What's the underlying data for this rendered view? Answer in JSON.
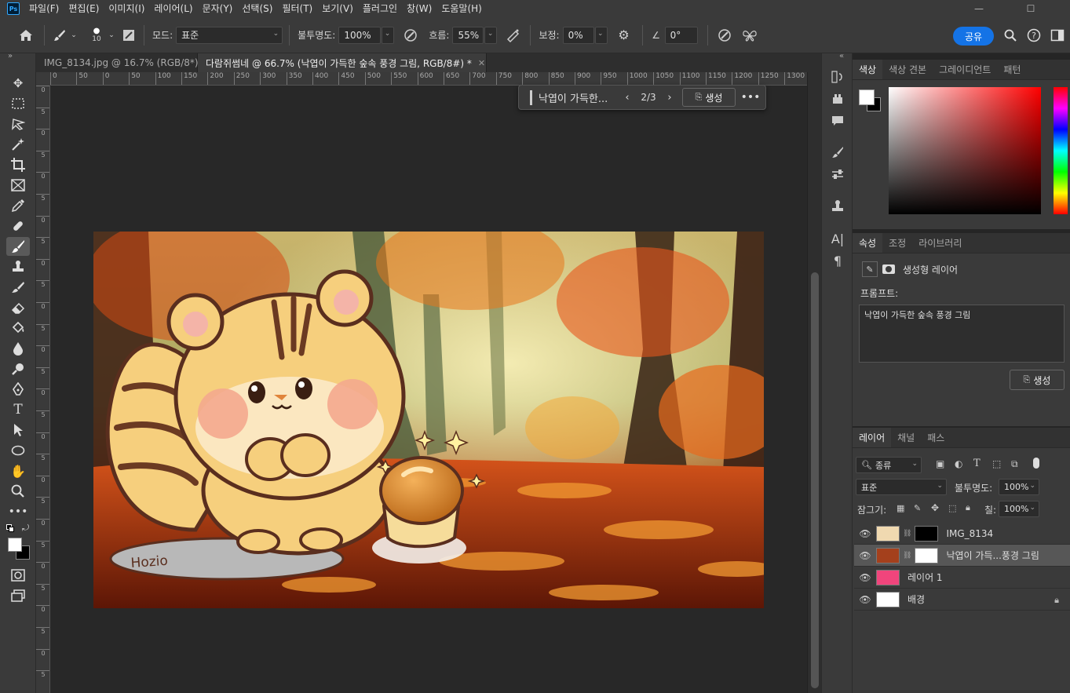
{
  "menubar": {
    "items": [
      "파일(F)",
      "편집(E)",
      "이미지(I)",
      "레이어(L)",
      "문자(Y)",
      "선택(S)",
      "필터(T)",
      "보기(V)",
      "플러그인",
      "창(W)",
      "도움말(H)"
    ],
    "logo": "Ps"
  },
  "options": {
    "brush_size": "10",
    "mode_label": "모드:",
    "mode_value": "표준",
    "opacity_label": "불투명도:",
    "opacity_value": "100%",
    "flow_label": "흐름:",
    "flow_value": "55%",
    "smoothing_label": "보정:",
    "smoothing_value": "0%",
    "angle_value": "0°",
    "share_label": "공유"
  },
  "tabs": [
    {
      "label": "IMG_8134.jpg @ 16.7% (RGB/8*)",
      "active": false
    },
    {
      "label": "다람쥐썸네 @ 66.7% (낙엽이 가득한 숲속 풍경 그림, RGB/8#) *",
      "active": true
    }
  ],
  "ruler": {
    "h_ticks": [
      "0",
      "50",
      "0",
      "50",
      "100",
      "150",
      "200",
      "250",
      "300",
      "350",
      "400",
      "450",
      "500",
      "550",
      "600",
      "650",
      "700",
      "750",
      "800",
      "850",
      "900",
      "950",
      "1000",
      "1050",
      "1100",
      "1150",
      "1200",
      "1250",
      "1300",
      "13"
    ],
    "v_ticks": [
      "0",
      "5",
      "0",
      "5",
      "0",
      "5",
      "0",
      "5",
      "0",
      "5",
      "0",
      "5",
      "0",
      "5",
      "0",
      "5",
      "0",
      "5",
      "0",
      "5",
      "0",
      "5",
      "0",
      "5",
      "0",
      "5",
      "0",
      "5"
    ]
  },
  "contextbar": {
    "prompt": "낙엽이 가득한...",
    "page": "2/3",
    "generate_label": "생성"
  },
  "canvas": {
    "signature": "Hozio",
    "colors": {
      "squirrel_body": "#f6cf7d",
      "outline": "#5a2e1e",
      "cheek": "#f4a98e",
      "leaf_orange": "#e8561c",
      "leaf_yellow": "#f2a93a"
    }
  },
  "color_panel": {
    "tabs": [
      "색상",
      "색상 견본",
      "그레이디언트",
      "패턴"
    ]
  },
  "properties_panel": {
    "tabs": [
      "속성",
      "조정",
      "라이브러리"
    ],
    "layer_type": "생성형 레이어",
    "prompt_label": "프롬프트:",
    "prompt_value": "낙엽이 가득한 숲속 풍경 그림",
    "generate_label": "생성"
  },
  "layers_panel": {
    "tabs": [
      "레이어",
      "채널",
      "패스"
    ],
    "filter_label": "종류",
    "blend_mode": "표준",
    "opacity_label": "불투명도:",
    "opacity_value": "100%",
    "lock_label": "잠그기:",
    "fill_label": "칠:",
    "fill_value": "100%",
    "layers": [
      {
        "name": "IMG_8134",
        "thumb_color": "#f0d9b0",
        "selected": false
      },
      {
        "name": "낙엽이 가득...풍경 그림",
        "thumb_color": "#a4401c",
        "selected": true
      },
      {
        "name": "레이어 1",
        "thumb_color": "#f0457c",
        "selected": false
      },
      {
        "name": "배경",
        "thumb_color": "#ffffff",
        "selected": false
      }
    ]
  }
}
